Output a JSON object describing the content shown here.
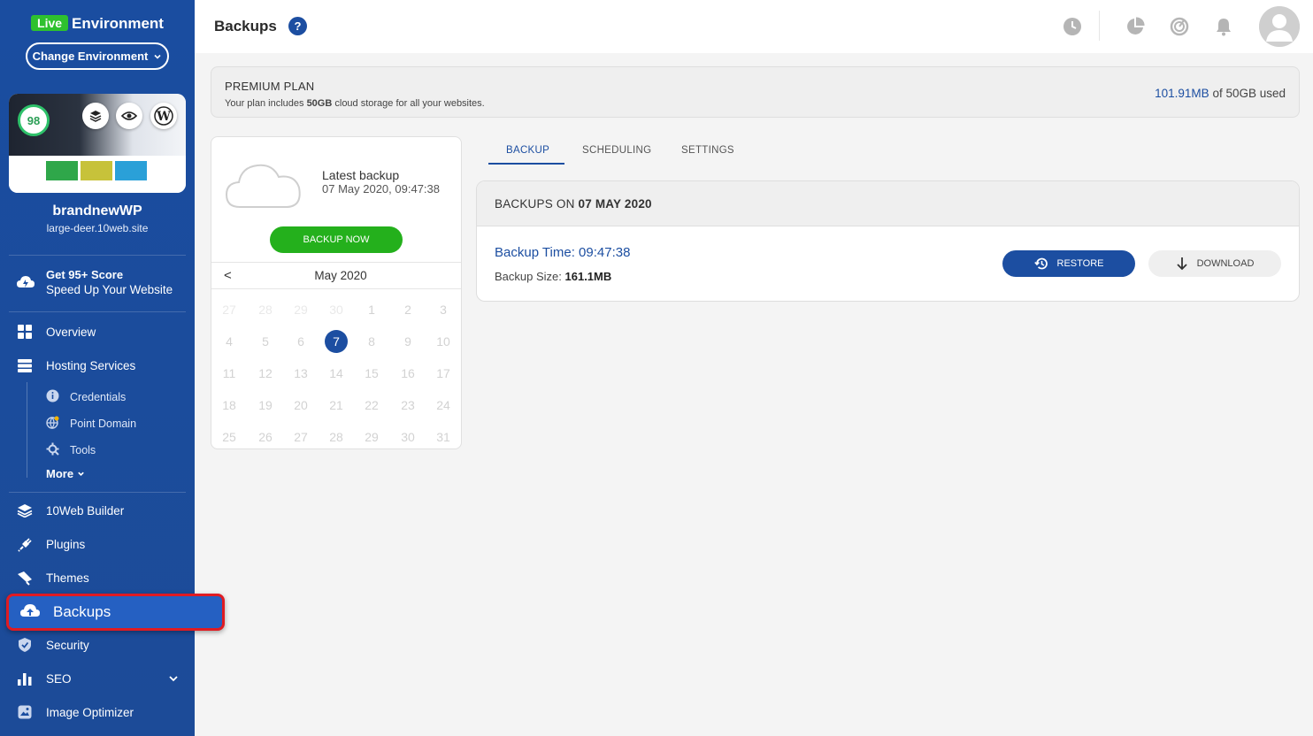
{
  "sidebar": {
    "env_badge": "Live",
    "env_title": "Environment",
    "change_env_label": "Change Environment",
    "site": {
      "score": "98",
      "name": "brandnewWP",
      "url": "large-deer.10web.site"
    },
    "promo": {
      "line1": "Get 95+ Score",
      "line2": "Speed Up Your Website"
    },
    "items": [
      {
        "label": "Overview",
        "icon": "grid-icon"
      },
      {
        "label": "Hosting Services",
        "icon": "server-icon"
      },
      {
        "label": "10Web Builder",
        "icon": "layers-icon"
      },
      {
        "label": "Plugins",
        "icon": "plug-icon"
      },
      {
        "label": "Themes",
        "icon": "brush-icon"
      },
      {
        "label": "Backups",
        "icon": "cloud-backup-icon"
      },
      {
        "label": "Security",
        "icon": "shield-icon"
      },
      {
        "label": "SEO",
        "icon": "bar-chart-icon"
      },
      {
        "label": "Image Optimizer",
        "icon": "image-icon"
      }
    ],
    "sub_items": [
      {
        "label": "Credentials",
        "icon": "info-icon"
      },
      {
        "label": "Point Domain",
        "icon": "globe-icon"
      },
      {
        "label": "Tools",
        "icon": "tools-icon"
      }
    ],
    "more_label": "More"
  },
  "header": {
    "title": "Backups",
    "help": "?"
  },
  "plan": {
    "title": "PREMIUM PLAN",
    "desc_pre": "Your plan includes ",
    "desc_bold": "50GB",
    "desc_post": " cloud storage for all your websites.",
    "used": "101.91MB",
    "usage_rest": " of 50GB used"
  },
  "latest": {
    "label": "Latest backup",
    "date": "07 May 2020, 09:47:38",
    "button": "BACKUP NOW"
  },
  "calendar": {
    "prev": "<",
    "month": "May 2020",
    "weeks": [
      [
        {
          "d": "27",
          "m": true
        },
        {
          "d": "28",
          "m": true
        },
        {
          "d": "29",
          "m": true
        },
        {
          "d": "30",
          "m": true
        },
        {
          "d": "1"
        },
        {
          "d": "2"
        },
        {
          "d": "3"
        }
      ],
      [
        {
          "d": "4"
        },
        {
          "d": "5"
        },
        {
          "d": "6"
        },
        {
          "d": "7",
          "sel": true
        },
        {
          "d": "8"
        },
        {
          "d": "9"
        },
        {
          "d": "10"
        }
      ],
      [
        {
          "d": "11"
        },
        {
          "d": "12"
        },
        {
          "d": "13"
        },
        {
          "d": "14"
        },
        {
          "d": "15"
        },
        {
          "d": "16"
        },
        {
          "d": "17"
        }
      ],
      [
        {
          "d": "18"
        },
        {
          "d": "19"
        },
        {
          "d": "20"
        },
        {
          "d": "21"
        },
        {
          "d": "22"
        },
        {
          "d": "23"
        },
        {
          "d": "24"
        }
      ],
      [
        {
          "d": "25"
        },
        {
          "d": "26"
        },
        {
          "d": "27"
        },
        {
          "d": "28"
        },
        {
          "d": "29"
        },
        {
          "d": "30"
        },
        {
          "d": "31"
        }
      ]
    ]
  },
  "tabs": [
    {
      "label": "BACKUP",
      "active": true
    },
    {
      "label": "SCHEDULING"
    },
    {
      "label": "SETTINGS"
    }
  ],
  "backups": {
    "heading_pre": "BACKUPS ON ",
    "heading_date": "07 MAY 2020",
    "time_label": "Backup Time: 09:47:38",
    "size_label": "Backup Size: ",
    "size_value": "161.1MB",
    "restore": "RESTORE",
    "download": "DOWNLOAD"
  },
  "colors": {
    "brand_blue": "#1c4ea1",
    "sidebar": "#1a4da0",
    "green": "#24b01c",
    "active_outline": "#e01b22"
  }
}
